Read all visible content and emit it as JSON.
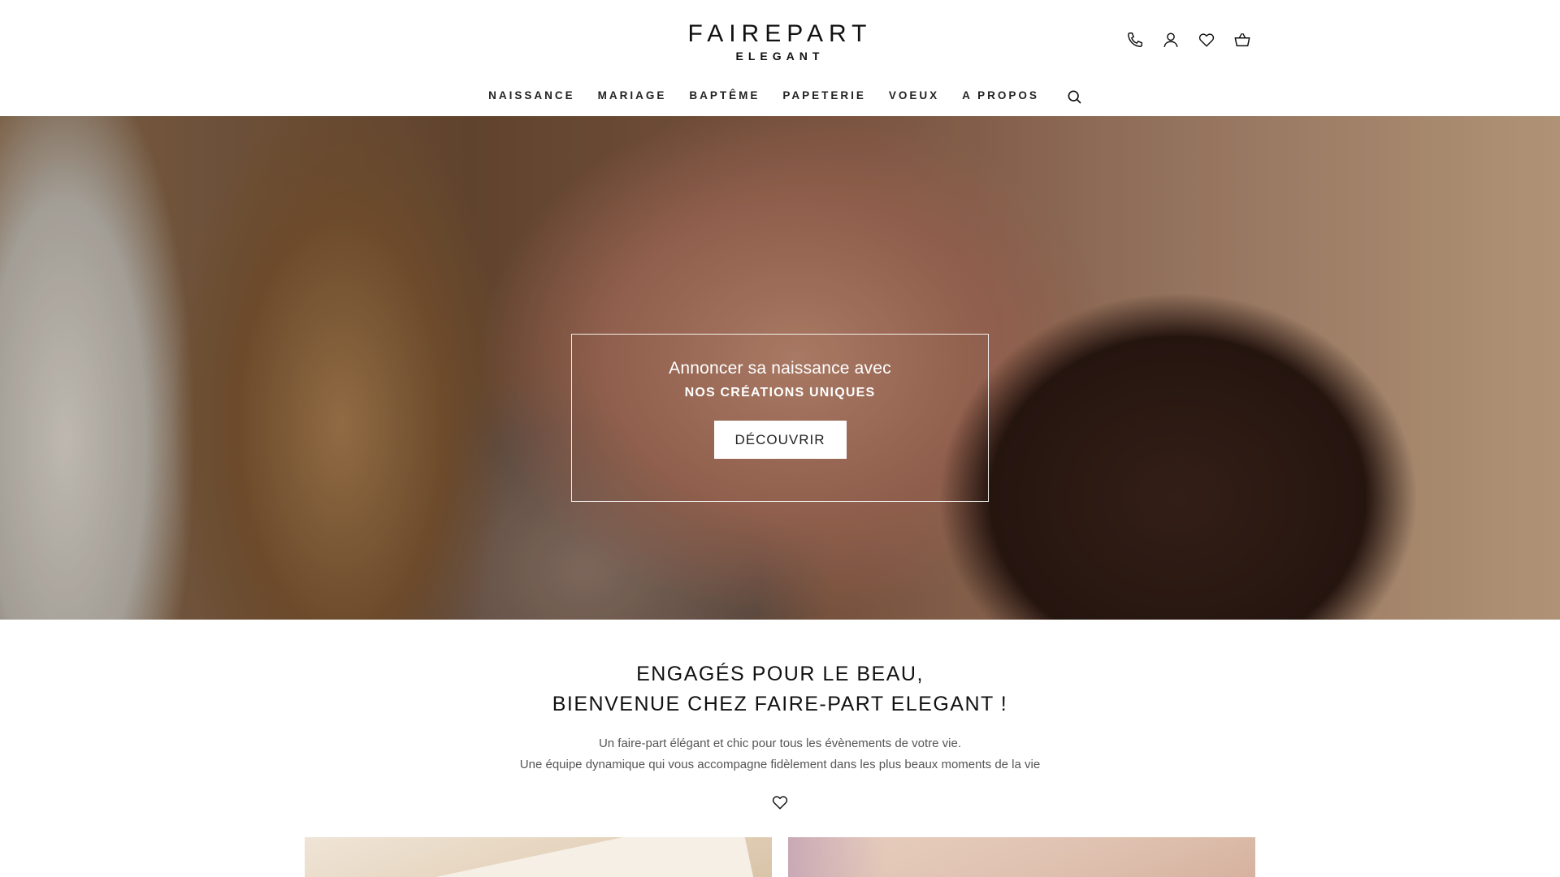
{
  "header": {
    "logo_main": "FAIREPART",
    "logo_sub": "ELEGANT",
    "icons": [
      "phone-icon",
      "user-icon",
      "heart-icon",
      "basket-icon"
    ]
  },
  "nav": {
    "items": [
      "NAISSANCE",
      "MARIAGE",
      "BAPTÊME",
      "PAPETERIE",
      "VOEUX",
      "A PROPOS"
    ]
  },
  "hero": {
    "line1": "Annoncer sa naissance avec",
    "line2": "NOS CRÉATIONS UNIQUES",
    "button": "DÉCOUVRIR"
  },
  "welcome": {
    "title_line1": "ENGAGÉS POUR LE BEAU,",
    "title_line2": "BIENVENUE CHEZ FAIRE-PART ELEGANT !",
    "text_line1": "Un faire-part élégant et chic pour tous les évènements de votre vie.",
    "text_line2": "Une équipe dynamique qui vous accompagne fidèlement dans les plus beaux moments de la vie"
  }
}
